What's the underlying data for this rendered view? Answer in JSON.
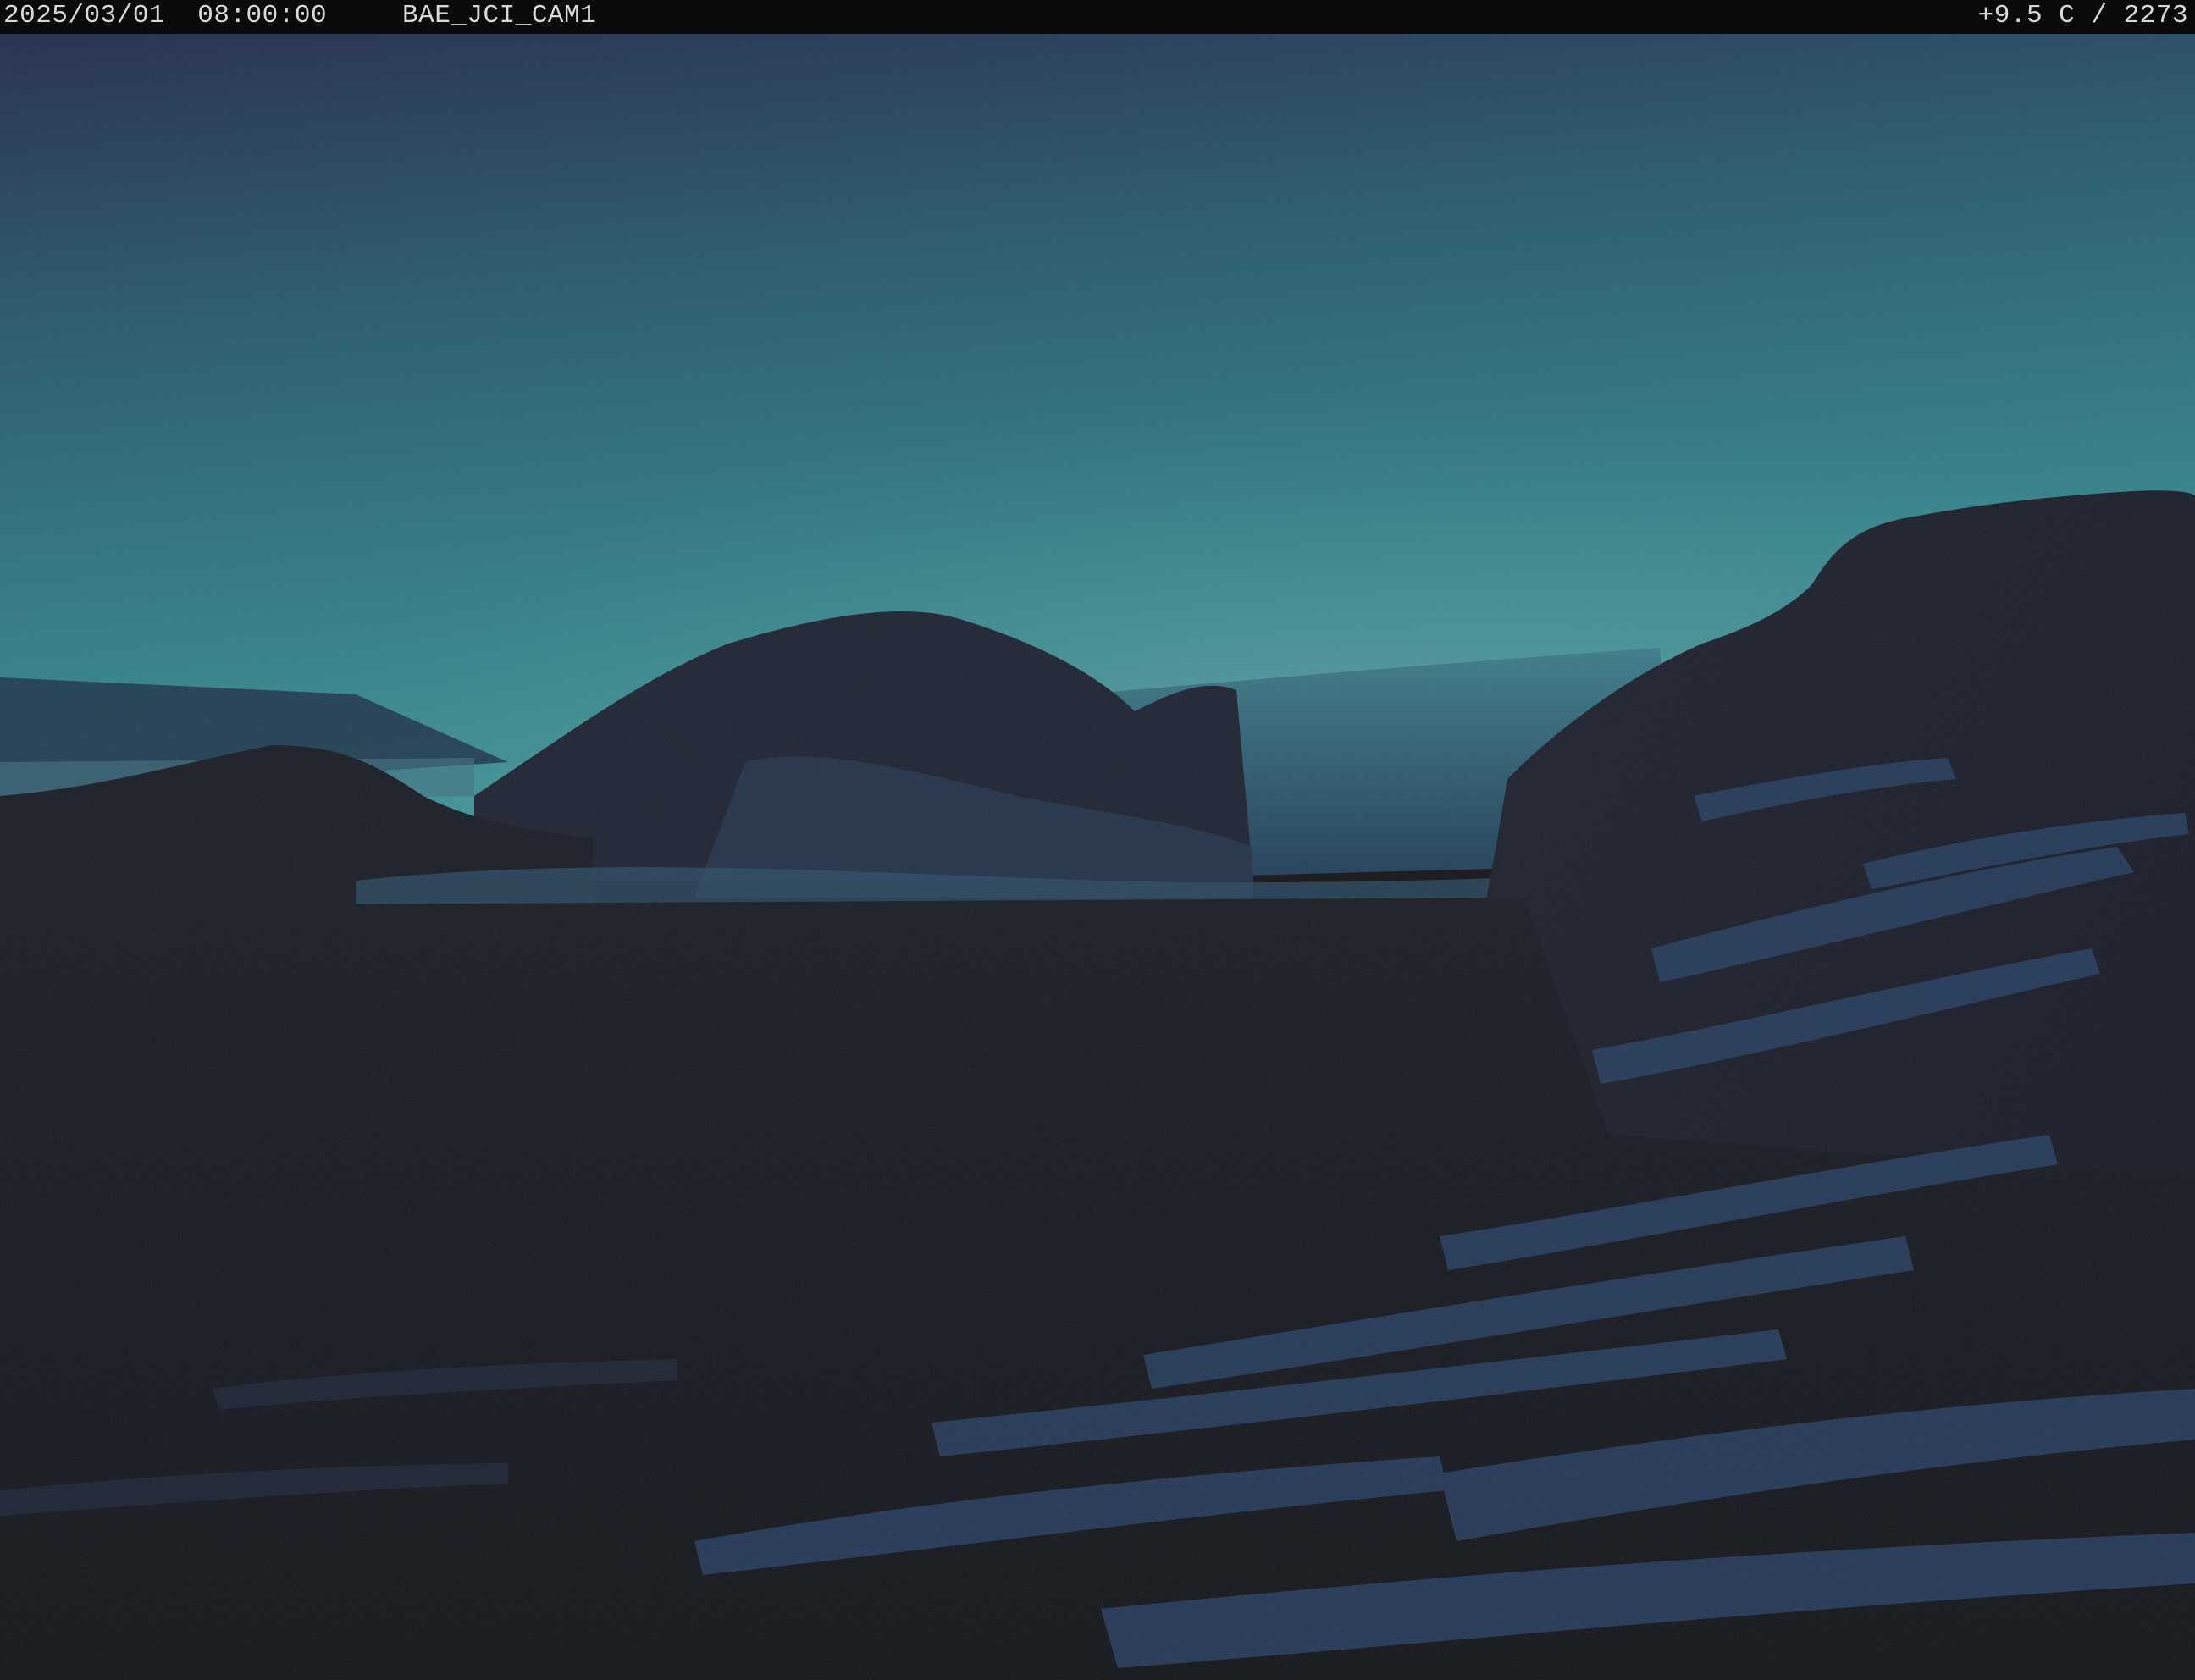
{
  "overlay": {
    "timestamp": "2025/03/01  08:00:00",
    "camera_id": "BAE_JCI_CAM1",
    "temperature_count": "+9.5 C / 2273"
  },
  "scene": {
    "description_icons": [
      "mountain-ridge",
      "glacier",
      "rocky-cliff",
      "snow-patches"
    ],
    "colors": {
      "sky_top": "#222b52",
      "sky_mid": "#25646f",
      "sky_horizon": "#3a8c8e",
      "hill_dark": "#14161f",
      "glacier": "#28586a",
      "snow": "#24385a",
      "ground": "#101116"
    }
  }
}
